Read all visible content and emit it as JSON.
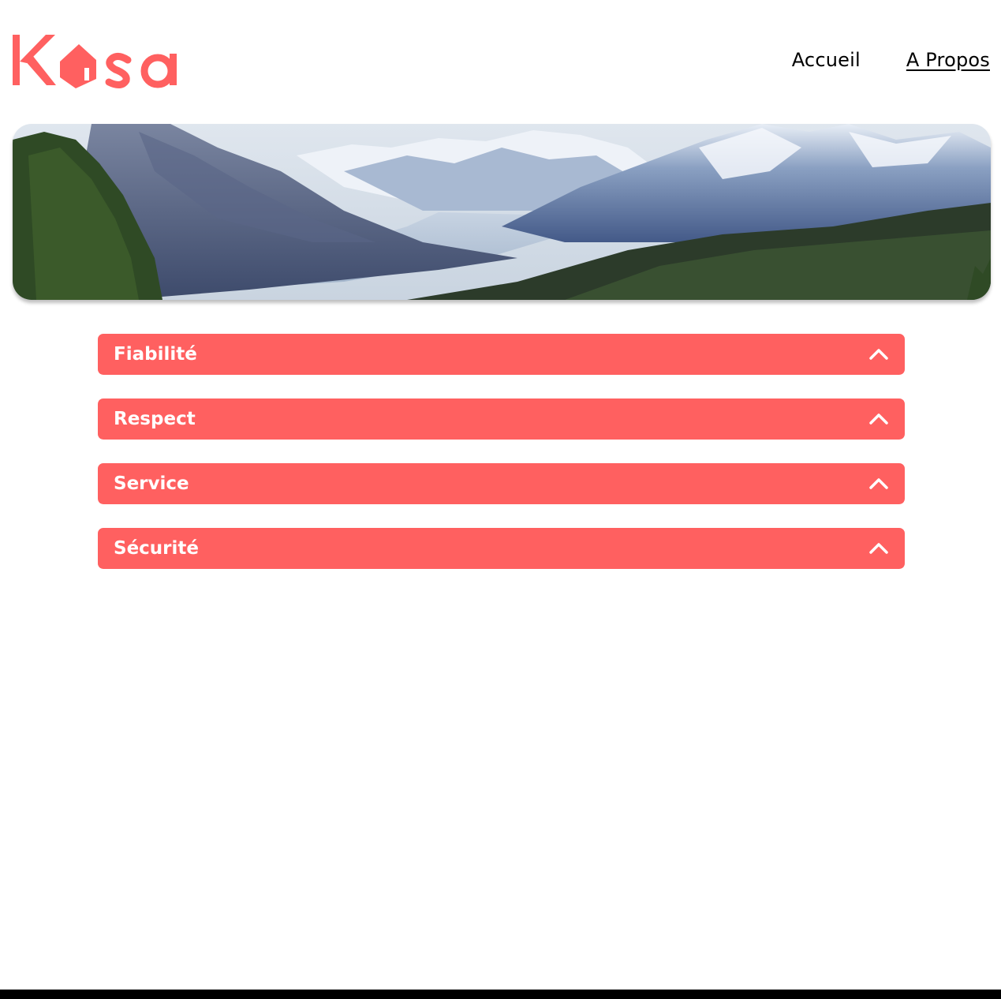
{
  "brand": {
    "name": "Kasa",
    "color": "#FF6060"
  },
  "nav": {
    "items": [
      {
        "label": "Accueil",
        "active": false
      },
      {
        "label": "A Propos",
        "active": true
      }
    ]
  },
  "banner": {
    "icon": "mountain-landscape-image"
  },
  "collapses": [
    {
      "title": "Fiabilité",
      "icon": "chevron-up-icon"
    },
    {
      "title": "Respect",
      "icon": "chevron-up-icon"
    },
    {
      "title": "Service",
      "icon": "chevron-up-icon"
    },
    {
      "title": "Sécurité",
      "icon": "chevron-up-icon"
    }
  ]
}
